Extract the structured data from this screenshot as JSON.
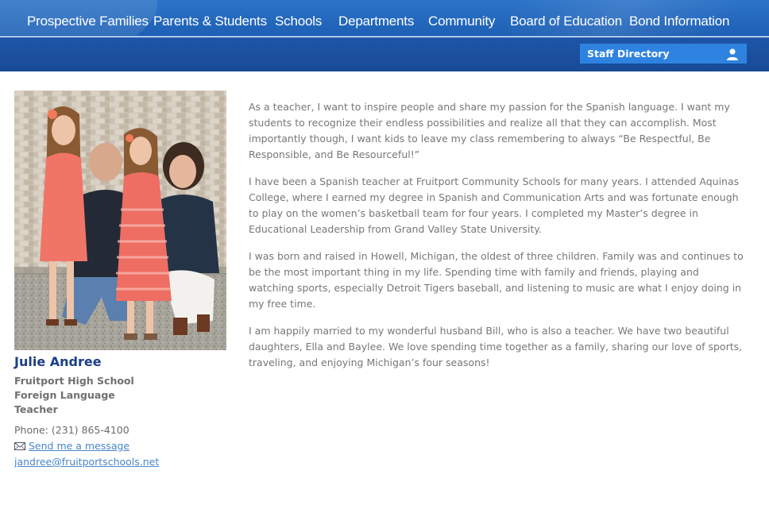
{
  "nav": {
    "items": [
      {
        "label": "Prospective Families"
      },
      {
        "label": "Parents & Students"
      },
      {
        "label": "Schools"
      },
      {
        "label": "Departments"
      },
      {
        "label": "Community"
      },
      {
        "label": "Board of Education"
      },
      {
        "label": "Bond Information"
      }
    ]
  },
  "subbar": {
    "staff_directory_label": "Staff Directory",
    "staff_directory_icon": "user-icon"
  },
  "profile": {
    "name": "Julie Andree",
    "school": "Fruitport High School",
    "department": "Foreign Language",
    "title": "Teacher",
    "phone": "Phone: (231) 865-4100",
    "message_link": "Send me a message",
    "message_icon": "envelope-icon",
    "email": "jandree@fruitportschools.net"
  },
  "bio": {
    "paragraphs": [
      "As a teacher, I want to inspire people and share my passion for the Spanish language. I want my students to recognize their endless possibilities and realize all that they can accomplish. Most importantly though, I want kids to leave my class remembering to always “Be Respectful, Be Responsible, and Be Resourceful!”",
      "I have been a Spanish teacher at Fruitport Community Schools for many years. I attended Aquinas College, where I earned my degree in Spanish and Communication Arts and was fortunate enough to play on the women’s basketball team for four years. I completed my Master’s degree in Educational Leadership from Grand Valley State University.",
      "I was born and raised in Howell, Michigan, the oldest of three children. Family was and continues to be the most important thing in my life. Spending time with family and friends, playing and watching sports, especially Detroit Tigers baseball, and listening to music are what I enjoy doing in my free time.",
      "I am happily married to my wonderful husband Bill, who is also a teacher. We have two beautiful daughters, Ella and Baylee. We love spending time together as a family, sharing our love of sports, traveling, and enjoying Michigan’s four seasons!"
    ]
  },
  "colors": {
    "nav_bg": "#2d74c8",
    "subbar_bg": "#1e56a8",
    "staff_button": "#2f83e0",
    "name_color": "#1c3f86",
    "link_color": "#4a86c8"
  }
}
